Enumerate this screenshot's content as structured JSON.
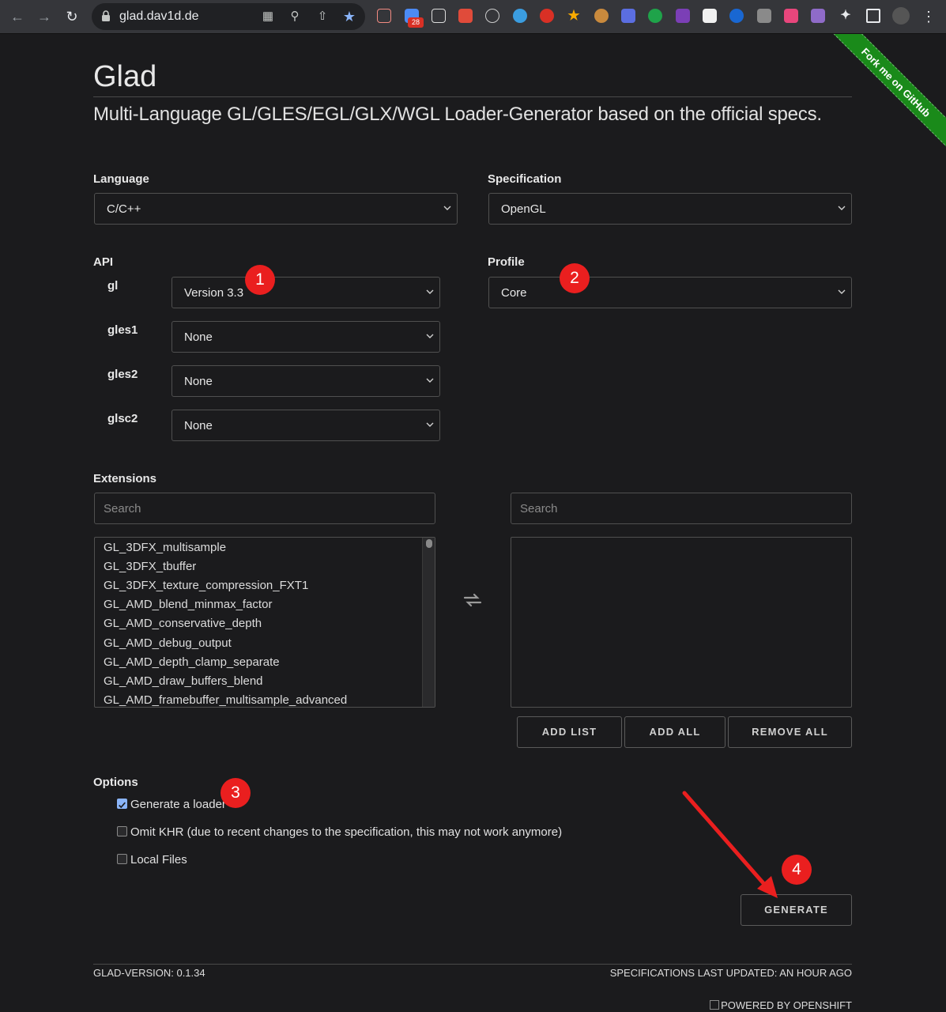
{
  "browser": {
    "url": "glad.dav1d.de",
    "badge_count": "28"
  },
  "ribbon": {
    "text": "Fork me on GitHub"
  },
  "header": {
    "title": "Glad",
    "subtitle": "Multi-Language GL/GLES/EGL/GLX/WGL Loader-Generator based on the official specs."
  },
  "language": {
    "label": "Language",
    "value": "C/C++"
  },
  "specification": {
    "label": "Specification",
    "value": "OpenGL"
  },
  "api": {
    "label": "API",
    "rows": [
      {
        "name": "gl",
        "value": "Version 3.3"
      },
      {
        "name": "gles1",
        "value": "None"
      },
      {
        "name": "gles2",
        "value": "None"
      },
      {
        "name": "glsc2",
        "value": "None"
      }
    ]
  },
  "profile": {
    "label": "Profile",
    "value": "Core"
  },
  "extensions": {
    "label": "Extensions",
    "left_search_placeholder": "Search",
    "right_search_placeholder": "Search",
    "available": [
      "GL_3DFX_multisample",
      "GL_3DFX_tbuffer",
      "GL_3DFX_texture_compression_FXT1",
      "GL_AMD_blend_minmax_factor",
      "GL_AMD_conservative_depth",
      "GL_AMD_debug_output",
      "GL_AMD_depth_clamp_separate",
      "GL_AMD_draw_buffers_blend",
      "GL_AMD_framebuffer_multisample_advanced"
    ],
    "buttons": {
      "add_list": "ADD LIST",
      "add_all": "ADD ALL",
      "remove_all": "REMOVE ALL"
    }
  },
  "options": {
    "label": "Options",
    "items": [
      {
        "label": "Generate a loader",
        "checked": true
      },
      {
        "label": "Omit KHR (due to recent changes to the specification, this may not work anymore)",
        "checked": false
      },
      {
        "label": "Local Files",
        "checked": false
      }
    ]
  },
  "generate_label": "GENERATE",
  "markers": [
    "1",
    "2",
    "3",
    "4"
  ],
  "footer": {
    "version": "GLAD-VERSION: 0.1.34",
    "updated": "SPECIFICATIONS LAST UPDATED: AN HOUR AGO",
    "powered": "POWERED BY OPENSHIFT"
  },
  "colors": {
    "marker": "#ea1f1f",
    "ribbon": "#1a8a1a",
    "background": "#1b1b1d"
  }
}
